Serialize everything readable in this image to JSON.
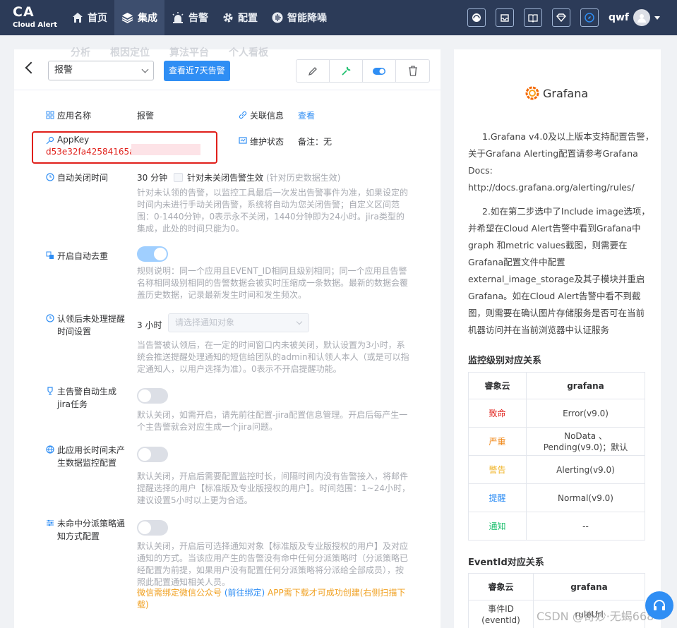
{
  "brand": {
    "name": "CA",
    "subtitle": "Cloud Alert"
  },
  "nav": [
    {
      "label": "首页",
      "icon": "home-icon"
    },
    {
      "label": "集成",
      "icon": "layers-icon",
      "active": true
    },
    {
      "label": "告警",
      "icon": "alarm-icon"
    },
    {
      "label": "配置",
      "icon": "gear-icon"
    },
    {
      "label": "智能降噪",
      "icon": "noise-icon"
    }
  ],
  "ghost_nav": [
    "分析",
    "根因定位",
    "算法平台",
    "个人看板"
  ],
  "user": {
    "name": "qwf"
  },
  "toolbar": {
    "select_value": "报警",
    "primary_button": "查看近7天告警"
  },
  "fields": {
    "app_name_label": "应用名称",
    "app_name_value": "报警",
    "related_label": "关联信息",
    "related_link": "查看",
    "appkey_label": "AppKey",
    "appkey_value": "d53e32fa42584165a8",
    "maint_label": "维护状态",
    "maint_value": "备注：无",
    "auto_close_label": "自动关闭时间",
    "auto_close_value": "30 分钟",
    "auto_close_checkbox": "针对未关闭告警生效",
    "auto_close_checkbox_hint": "(针对历史数据生效)",
    "auto_close_desc": "针对未认领的告警，以监控工具最后一次发出告警事件为准，如果设定的时间内未进行手动关闭告警，系统将自动为您关闭告警；自定义区间范围：0-1440分钟，0表示永不关闭，1440分钟即为24小时。jira类型的集成，此处的时间只能为0。",
    "dedup_label": "开启自动去重",
    "dedup_desc": "规则说明：同一个应用且EVENT_ID相同且级别相同；同一个应用且告警名称相同级别相同的告警数据会被实时压缩成一条数据。最新的数据会覆盖历史数据，记录最新发生时间和发生频次。",
    "remind_label": "认领后未处理提醒时间设置",
    "remind_value": "3 小时",
    "remind_placeholder": "请选择通知对象",
    "remind_desc": "当告警被认领后，在一定的时间窗口内未被关闭，默认设置为3小时，系统会推送提醒处理通知的短信给团队的admin和认领人本人（或是可以指定通知人，以用户选择为准）。0表示不开启提醒功能。",
    "jira_label": "主告警自动生成jira任务",
    "jira_desc": "默认关闭，如需开启，请先前往配置-jira配置信息管理。开启后每产生一个主告警就会对应生成一个jira问题。",
    "nodata_label": "此应用长时间未产生数据监控配置",
    "nodata_desc": "默认关闭，开启后需要配置监控时长，间隔时间内没有告警接入，将邮件提醒选择的用户【标准版及专业版授权的用户】。时间范围：1~24小时，建议设置5小时以上更为合适。",
    "dispatch_label": "未命中分派策略通知方式配置",
    "dispatch_desc": "默认关闭，开启后可选择通知对象【标准版及专业版授权的用户】及对应通知的方式。当该应用产生的告警没有命中任何分派策略时（分派策略已经配置为前提，如果用户没有配置任何分派策略将分派给全部成员），按照此配置通知相关人员。",
    "dispatch_warn_a": "微信需绑定微信公众号",
    "dispatch_warn_link": "(前往绑定)",
    "dispatch_warn_b": "APP需下载才可成功创建(右侧扫描下载)"
  },
  "toggles": {
    "dedup": true,
    "jira": false,
    "nodata": false,
    "dispatch": false
  },
  "side": {
    "title": "Grafana",
    "p1": [
      "1.Grafana v4.0及以上版本支持配置告警，",
      "关于Grafana Alerting配置请参考Grafana",
      "Docs:",
      "http://docs.grafana.org/alerting/rules/"
    ],
    "p2": [
      "2.如在第二步选中了Include image选项，",
      "并希望在Cloud Alert告警中看到Grafana中",
      "graph 和metric values截图，则需要在",
      "Grafana配置文件中配置",
      "external_image_storage及其子模块并重启",
      "Grafana。如在Cloud Alert告警中看不到截",
      "图，则需要在确认图片存储服务是否可在当前",
      "机器访问并在当前浏览器中认证服务"
    ],
    "level_title": "监控级别对应关系",
    "level_headers": [
      "睿象云",
      "grafana"
    ],
    "levels": [
      {
        "name": "致命",
        "color": "#e0201b",
        "value": "Error(v9.0)"
      },
      {
        "name": "严重",
        "color": "#f08a1c",
        "value": "NoData 、 Pending(v9.0)；默认"
      },
      {
        "name": "警告",
        "color": "#f0b429",
        "value": "Alerting(v9.0)"
      },
      {
        "name": "提醒",
        "color": "#2f8ef4",
        "value": "Normal(v9.0)"
      },
      {
        "name": "通知",
        "color": "#19be6b",
        "value": "--"
      }
    ],
    "event_title": "EventId对应关系",
    "event_headers": [
      "睿象云",
      "grafana"
    ],
    "event_row": {
      "name": "事件ID (eventId)",
      "value": "ruleUrl"
    }
  },
  "watermark": "CSDN @奇妙·无蝎668"
}
